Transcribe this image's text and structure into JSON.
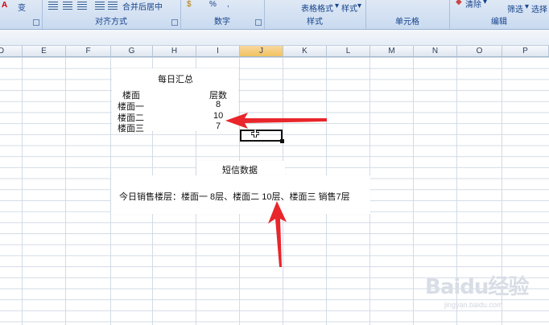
{
  "ribbon": {
    "groups": [
      {
        "title": "对齐方式"
      },
      {
        "title": "数字"
      },
      {
        "title": "样式"
      },
      {
        "title": "单元格"
      },
      {
        "title": "编辑"
      }
    ],
    "merge_center": "合并后居中",
    "table_format": "表格格式",
    "cell_style": "样式",
    "clear": "清除",
    "sort_filter": "筛选",
    "find_select": "选择",
    "percent": "%",
    "comma": ","
  },
  "columns": [
    "D",
    "E",
    "F",
    "G",
    "H",
    "I",
    "J",
    "K",
    "L",
    "M",
    "N",
    "O",
    "P"
  ],
  "selected_column": "J",
  "daily": {
    "title": "每日汇总",
    "header_floor": "楼面",
    "header_count": "层数",
    "rows": [
      {
        "floor": "楼面一",
        "count": "8"
      },
      {
        "floor": "楼面二",
        "count": "10"
      },
      {
        "floor": "楼面三",
        "count": "7"
      }
    ]
  },
  "sms": {
    "title": "短信数据",
    "text": "今日销售楼层：楼面一 8层、楼面二 10层、楼面三 销售7层"
  },
  "watermark": {
    "brand": "Baidu经验",
    "url": "jingyan.baidu.com"
  },
  "colors": {
    "arrow": "#e8262b",
    "select_col": "#f1c15f"
  }
}
